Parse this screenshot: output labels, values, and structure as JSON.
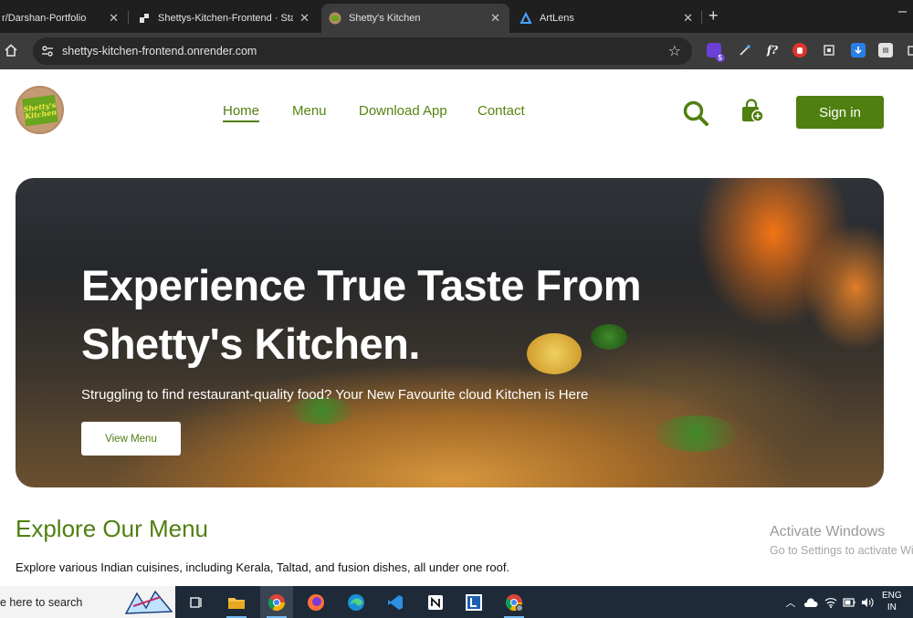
{
  "browser": {
    "tabs": [
      {
        "title": "r/Darshan-Portfolio",
        "active": false
      },
      {
        "title": "Shettys-Kitchen-Frontend · Stat",
        "active": false
      },
      {
        "title": "Shetty's Kitchen",
        "active": true
      },
      {
        "title": "ArtLens",
        "active": false
      }
    ],
    "url": "shettys-kitchen-frontend.onrender.com",
    "extension_badge": "5"
  },
  "site": {
    "logo_text": "Shetty's Kitchen",
    "nav": [
      {
        "label": "Home",
        "active": true
      },
      {
        "label": "Menu",
        "active": false
      },
      {
        "label": "Download App",
        "active": false
      },
      {
        "label": "Contact",
        "active": false
      }
    ],
    "signin_label": "Sign in",
    "hero": {
      "title_line1": "Experience True Taste From",
      "title_line2": "Shetty's Kitchen.",
      "subtitle": "Struggling to find restaurant-quality food? Your New Favourite cloud Kitchen is Here",
      "button_label": "View Menu"
    },
    "explore": {
      "title": "Explore Our Menu",
      "text": "Explore various Indian cuisines, including Kerala, Taltad, and fusion dishes, all under one roof."
    },
    "colors": {
      "brand_green": "#4f7f10",
      "link_green": "#55850f"
    }
  },
  "watermark": {
    "line1": "Activate Windows",
    "line2": "Go to Settings to activate Windows."
  },
  "taskbar": {
    "search_placeholder": "e here to search",
    "language_line1": "ENG",
    "language_line2": "IN"
  }
}
